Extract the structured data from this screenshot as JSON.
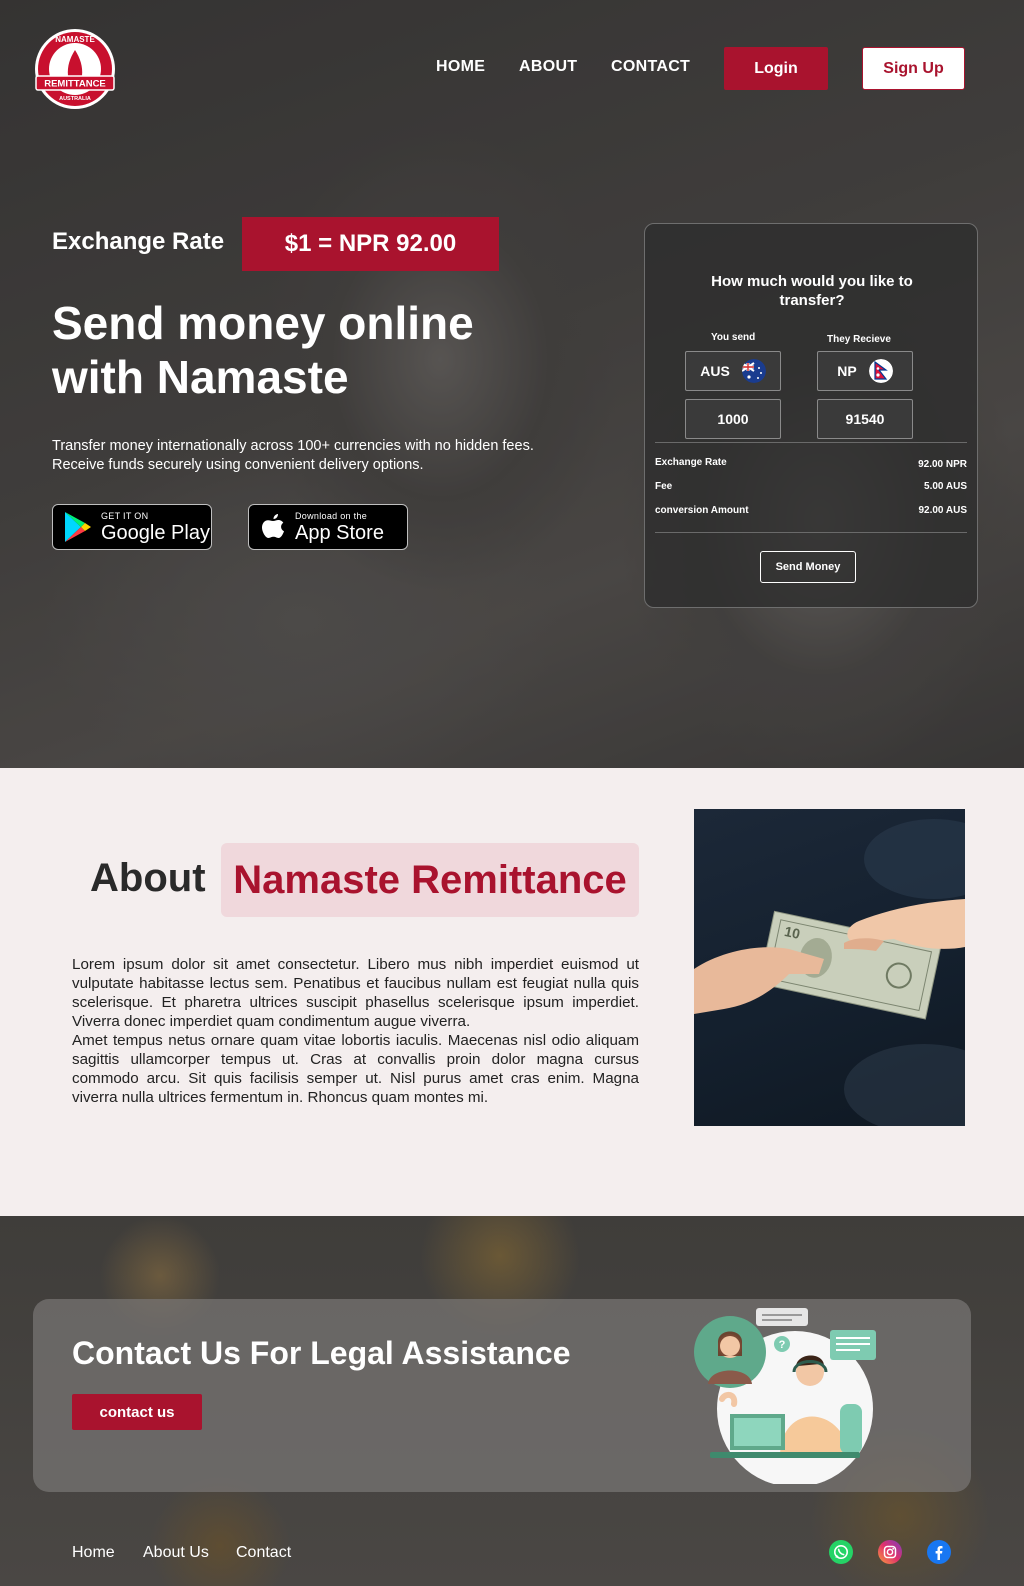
{
  "brand": {
    "logo_top": "NAMASTE",
    "logo_mid": "REMITTANCE",
    "logo_bottom": "AUSTRALIA",
    "accent": "#a9132e"
  },
  "nav": {
    "home": "HOME",
    "about": "ABOUT",
    "contact": "CONTACT",
    "login": "Login",
    "signup": "Sign Up"
  },
  "hero": {
    "rate_label": "Exchange Rate",
    "rate_value": "$1 = NPR 92.00",
    "title": "Send money online with Namaste",
    "description": "Transfer money internationally across 100+ currencies with no hidden fees. Receive funds securely using convenient delivery options.",
    "google_small": "GET IT ON",
    "google_big": "Google Play",
    "apple_small": "Download on the",
    "apple_big": "App Store"
  },
  "converter": {
    "question": "How much would you like to transfer?",
    "send_label": "You send",
    "receive_label": "They Recieve",
    "send_currency": "AUS",
    "receive_currency": "NP",
    "send_amount": "1000",
    "receive_amount": "91540",
    "rows": [
      {
        "label": "Exchange Rate",
        "value": "92.00 NPR"
      },
      {
        "label": "Fee",
        "value": "5.00 AUS"
      },
      {
        "label": "conversion Amount",
        "value": "92.00 AUS"
      }
    ],
    "button": "Send Money"
  },
  "about": {
    "title": "About",
    "badge": "Namaste Remittance",
    "paragraph1": "Lorem ipsum dolor sit amet consectetur. Libero mus nibh imperdiet euismod ut vulputate habitasse lectus sem. Penatibus et faucibus nullam est feugiat nulla quis scelerisque. Et pharetra ultrices suscipit phasellus scelerisque ipsum imperdiet. Viverra donec imperdiet quam condimentum augue viverra.",
    "paragraph2": "Amet tempus netus ornare quam vitae lobortis iaculis. Maecenas nisl odio aliquam sagittis ullamcorper tempus ut. Cras at convallis proin dolor magna cursus commodo arcu. Sit quis facilisis semper ut. Nisl purus amet cras enim. Magna viverra nulla ultrices fermentum in. Rhoncus quam montes mi."
  },
  "contact": {
    "title": "Contact Us For Legal Assistance",
    "button": "contact us"
  },
  "footer": {
    "links": [
      "Home",
      "About Us",
      "Contact"
    ],
    "social_icons": [
      "whatsapp-icon",
      "instagram-icon",
      "facebook-icon"
    ]
  }
}
